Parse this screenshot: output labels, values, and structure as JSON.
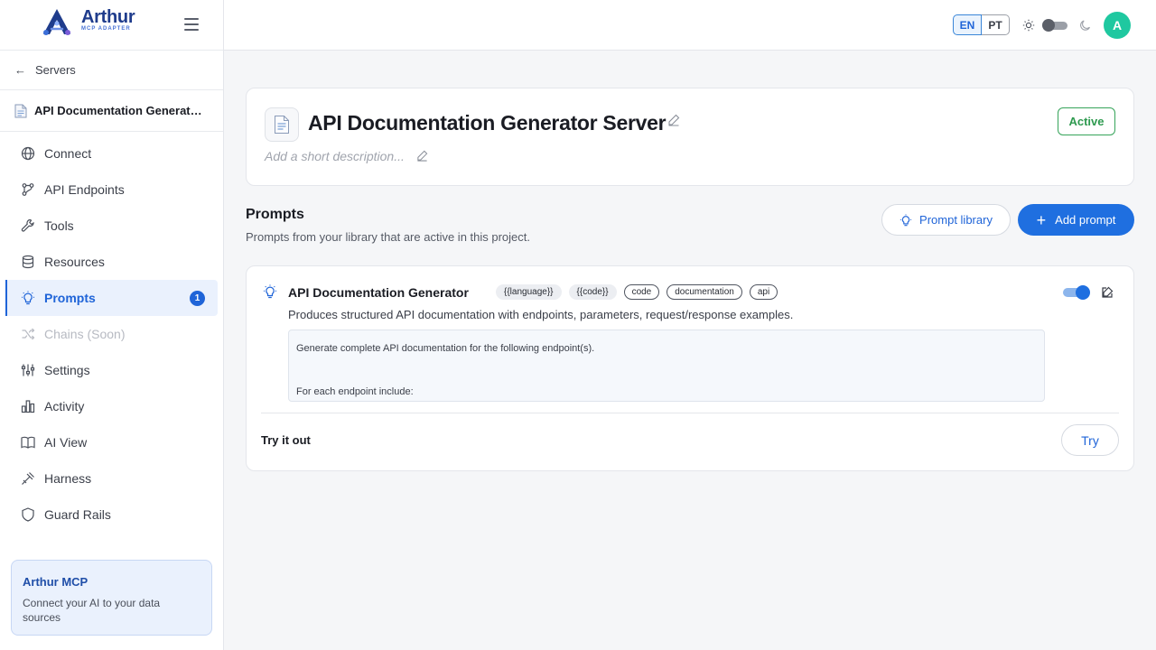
{
  "brand": {
    "name": "Arthur",
    "subtitle": "MCP ADAPTER",
    "logo_icon": "triangle-a-logo",
    "accent": "#1f3c8c"
  },
  "sidebar": {
    "back_label": "Servers",
    "server_name": "API Documentation Generator Server",
    "items": [
      {
        "label": "Connect",
        "icon": "globe-icon"
      },
      {
        "label": "API Endpoints",
        "icon": "endpoints-icon"
      },
      {
        "label": "Tools",
        "icon": "wrench-icon"
      },
      {
        "label": "Resources",
        "icon": "database-icon"
      },
      {
        "label": "Prompts",
        "icon": "bulb-icon",
        "badge": "1",
        "active": true
      },
      {
        "label": "Chains (Soon)",
        "icon": "shuffle-icon",
        "disabled": true
      },
      {
        "label": "Settings",
        "icon": "sliders-icon"
      },
      {
        "label": "Activity",
        "icon": "bar-chart-icon"
      },
      {
        "label": "AI View",
        "icon": "book-icon"
      },
      {
        "label": "Harness",
        "icon": "harness-icon"
      },
      {
        "label": "Guard Rails",
        "icon": "shield-icon"
      }
    ],
    "promo": {
      "title": "Arthur MCP",
      "text": "Connect your AI to your data sources"
    }
  },
  "topbar": {
    "lang_en": "EN",
    "lang_pt": "PT",
    "avatar_initial": "A",
    "avatar_color": "#1fc8a0"
  },
  "server": {
    "title": "API Documentation Generator Server",
    "description_placeholder": "Add a short description...",
    "status": "Active",
    "status_color": "#2e9a4f"
  },
  "prompts_section": {
    "title": "Prompts",
    "subtitle": "Prompts from your library that are active in this project.",
    "library_button": "Prompt library",
    "add_button": "Add prompt"
  },
  "prompt": {
    "title": "API Documentation Generator",
    "tags": [
      "{{language}}",
      "{{code}}",
      "code",
      "documentation",
      "api"
    ],
    "description": "Produces structured API documentation with endpoints, parameters, request/response examples.",
    "template_lines": [
      "Generate complete API documentation for the following endpoint(s).",
      "For each endpoint include:"
    ],
    "enabled": true,
    "try_label": "Try it out",
    "try_button": "Try"
  }
}
